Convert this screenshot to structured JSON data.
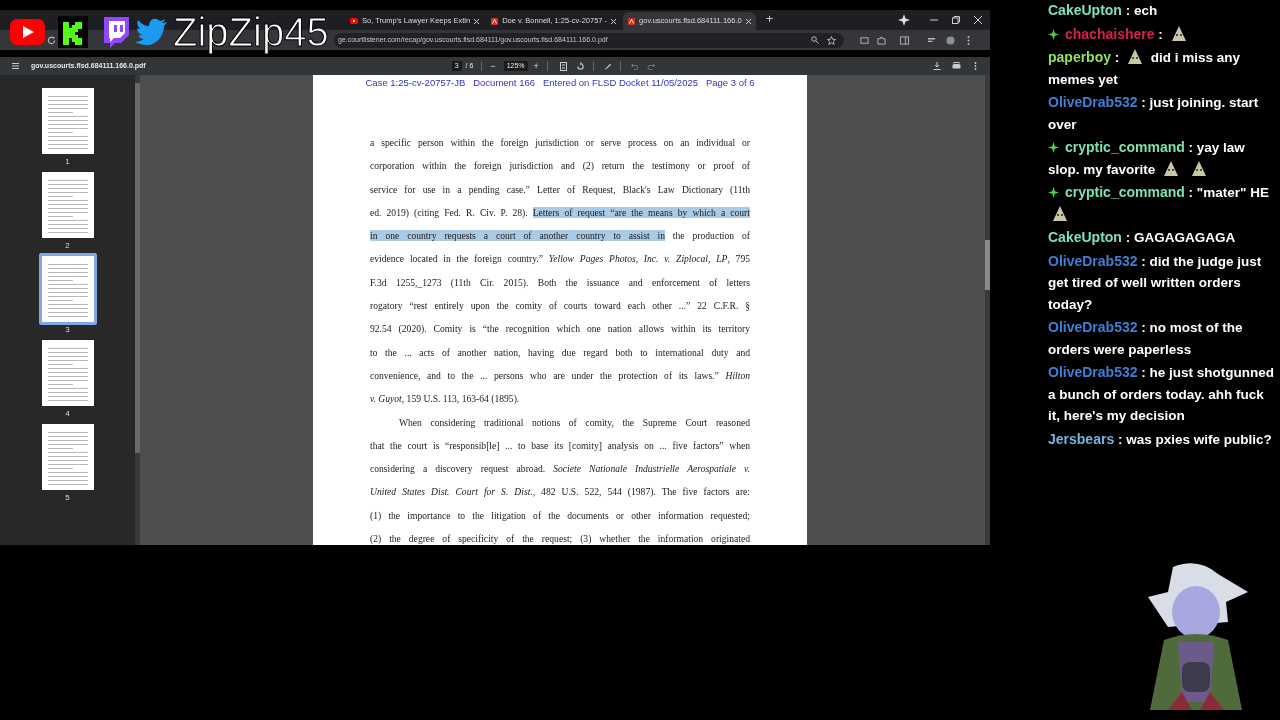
{
  "overlay": {
    "channel_name": "ZipZip45"
  },
  "tabs": [
    {
      "title": "So, Trump's Lawyer Keeps Extin",
      "kind": "video",
      "selected": false
    },
    {
      "title": "Doe v. Bonnell, 1:25-cv-20757 -",
      "kind": "pdf",
      "selected": false
    },
    {
      "title": "gov.uscourts.flsd.684111.166.0",
      "kind": "pdf",
      "selected": true
    }
  ],
  "new_tab_button": "+",
  "address_bar": {
    "url": "ge.courtlistener.com/recap/gov.uscourts.flsd.684111/gov.uscourts.flsd.684111.166.0.pdf"
  },
  "pdf_toolbar": {
    "filename": "gov.uscourts.flsd.684111.166.0.pdf",
    "page": "3",
    "page_total": "/ 6",
    "zoom_out": "−",
    "zoom": "125%",
    "zoom_in": "+"
  },
  "thumbnails": [
    {
      "label": "1",
      "selected": false
    },
    {
      "label": "2",
      "selected": false
    },
    {
      "label": "3",
      "selected": true
    },
    {
      "label": "4",
      "selected": false
    },
    {
      "label": "5",
      "selected": false
    }
  ],
  "document": {
    "header": "Case 1:25-cv-20757-JB   Document 166   Entered on FLSD Docket 11/05/2025   Page 3 of 6",
    "paragraphs": [
      {
        "indent": false,
        "continues": false,
        "lines": [
          [
            {
              "text": "a specific person within the foreign jurisdiction or serve process on an individual or",
              "highlighted": false
            }
          ],
          [
            {
              "text": "corporation within the foreign jurisdiction and (2) return the testimony or proof of",
              "highlighted": false
            }
          ],
          [
            {
              "text": "service for use in a pending case.” Letter of Request, Black's Law Dictionary (11th",
              "highlighted": false
            }
          ],
          [
            {
              "text": "ed. 2019) (citing Fed. R. Civ. P. 28). ",
              "highlighted": false
            },
            {
              "text": "Letters of request “are the means by which a court",
              "highlighted": true
            }
          ],
          [
            {
              "text": "in one country requests a court of another country to assist in",
              "highlighted": true
            },
            {
              "text": " the production of",
              "highlighted": false
            }
          ],
          [
            {
              "text": "evidence located in the foreign country.” *Yellow Pages Photos, Inc. v. Ziplocal, LP*, 795",
              "highlighted": false
            }
          ],
          [
            {
              "text": "F.3d 1255,_1273 (11th Cir. 2015).  Both the issuance and enforcement of letters",
              "highlighted": false
            }
          ],
          [
            {
              "text": "rogatory “rest entirely upon the comity of courts toward each other ...” 22 C.F.R. §",
              "highlighted": false
            }
          ],
          [
            {
              "text": "92.54 (2020). Comity is “the recognition which one nation allows within its territory",
              "highlighted": false
            }
          ],
          [
            {
              "text": "to the ... acts of another nation, having due regard both to international duty and",
              "highlighted": false
            }
          ],
          [
            {
              "text": "convenience, and to the ... persons who are under the protection of its laws.” *Hilton*",
              "highlighted": false
            }
          ],
          [
            {
              "text": "*v. Guyot,* 159 U.S. 113, 163-64 (1895).",
              "highlighted": false
            }
          ]
        ]
      },
      {
        "indent": true,
        "continues": true,
        "lines": [
          [
            {
              "text": "When considering traditional notions of comity, the Supreme Court reasoned",
              "highlighted": false
            }
          ],
          [
            {
              "text": "that the court is “responsib[le] ... to base its [comity] analysis on ... five factors” when",
              "highlighted": false
            }
          ],
          [
            {
              "text": "considering a discovery request abroad. *Societe Nationale Industrielle Aerospatiale v.*",
              "highlighted": false
            }
          ],
          [
            {
              "text": "*United States Dist. Court for S. Dist.*, 482 U.S. 522, 544 (1987). The five factors are:",
              "highlighted": false
            }
          ],
          [
            {
              "text": "(1) the importance to the litigation of the documents or other information requested;",
              "highlighted": false
            }
          ],
          [
            {
              "text": "(2) the degree of specificity of the request; (3) whether the information originated",
              "highlighted": false
            }
          ]
        ]
      }
    ]
  },
  "chat": [
    {
      "user": "CakeUpton",
      "color": "#7ee0c4",
      "badge": false,
      "parts": [
        {
          "kind": "text",
          "text": ": ech"
        }
      ]
    },
    {
      "user": "chachaishere",
      "color": "#d4244c",
      "badge": true,
      "parts": [
        {
          "kind": "text",
          "text": ":"
        },
        {
          "kind": "emote"
        }
      ]
    },
    {
      "user": "paperboy",
      "color": "#8ee45c",
      "badge": false,
      "parts": [
        {
          "kind": "text",
          "text": ":"
        },
        {
          "kind": "emote"
        },
        {
          "kind": "text",
          "text": "did i miss any memes yet"
        }
      ]
    },
    {
      "user": "OliveDrab532",
      "color": "#3f7fd4",
      "badge": false,
      "parts": [
        {
          "kind": "text",
          "text": ": just joining. start over"
        }
      ]
    },
    {
      "user": "cryptic_command",
      "color": "#7ee0b4",
      "badge": true,
      "parts": [
        {
          "kind": "text",
          "text": ": yay law slop. my favorite"
        },
        {
          "kind": "emote"
        },
        {
          "kind": "emote"
        }
      ]
    },
    {
      "user": "cryptic_command",
      "color": "#7ee0b4",
      "badge": true,
      "parts": [
        {
          "kind": "text",
          "text": ": \"mater\" HE"
        },
        {
          "kind": "emote"
        }
      ]
    },
    {
      "user": "CakeUpton",
      "color": "#7ee0c4",
      "badge": false,
      "parts": [
        {
          "kind": "text",
          "text": ": GAGAGAGAGA"
        }
      ]
    },
    {
      "user": "OliveDrab532",
      "color": "#3f7fd4",
      "badge": false,
      "parts": [
        {
          "kind": "text",
          "text": ": did the judge just get tired of well written orders today?"
        }
      ]
    },
    {
      "user": "OliveDrab532",
      "color": "#3f7fd4",
      "badge": false,
      "parts": [
        {
          "kind": "text",
          "text": ": no most of the orders were paperless"
        }
      ]
    },
    {
      "user": "OliveDrab532",
      "color": "#3f7fd4",
      "badge": false,
      "parts": [
        {
          "kind": "text",
          "text": ": he just shotgunned a bunch of orders today. ahh fuck it, here's my decision"
        }
      ]
    },
    {
      "user": "Jersbears",
      "color": "#76b4e4",
      "badge": false,
      "parts": [
        {
          "kind": "text",
          "text": ": was pxies wife public?"
        }
      ]
    }
  ]
}
